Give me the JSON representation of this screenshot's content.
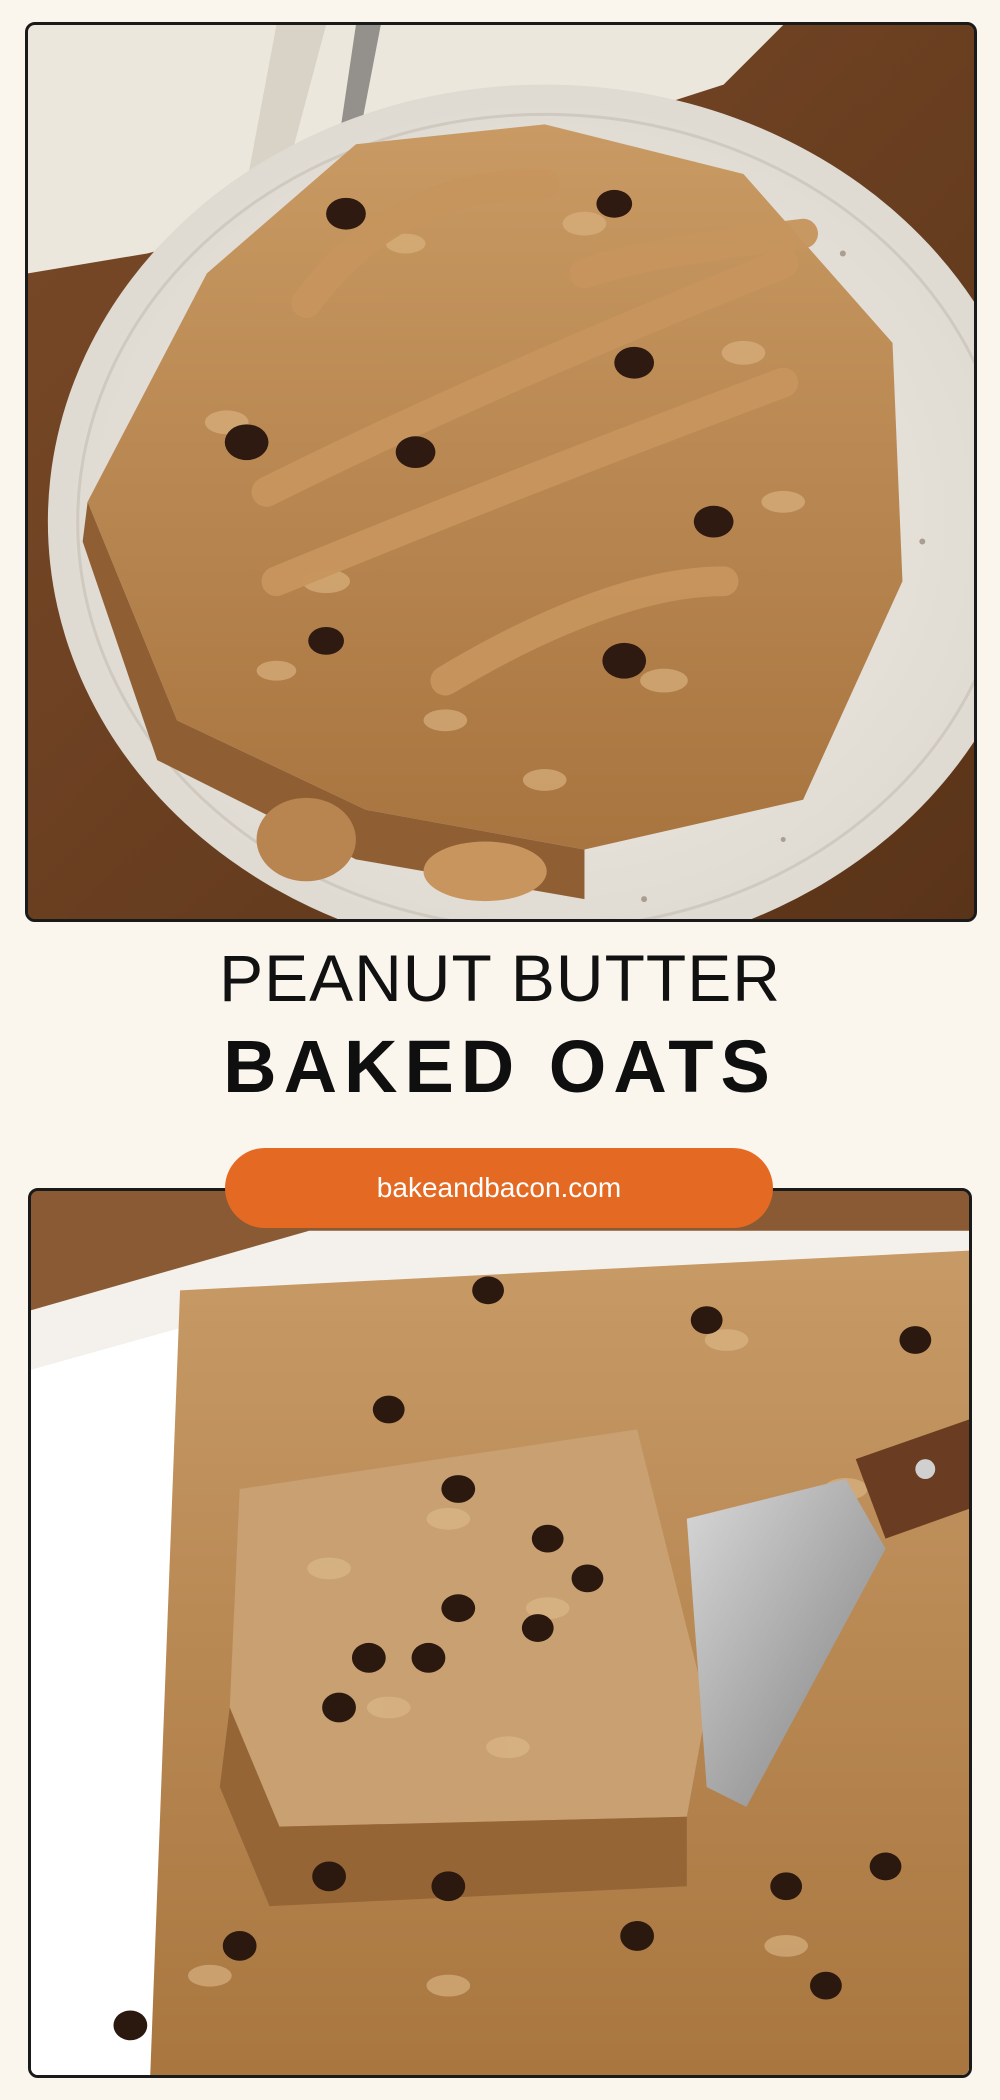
{
  "title": {
    "line1": "PEANUT BUTTER",
    "line2": "BAKED OATS"
  },
  "website": "bakeandbacon.com",
  "colors": {
    "background": "#faf6ee",
    "pill": "#e46a24",
    "title_text": "#111111",
    "pill_text": "#ffffff"
  }
}
